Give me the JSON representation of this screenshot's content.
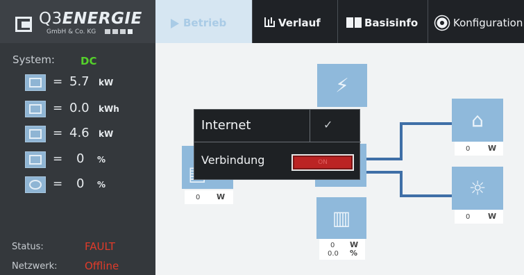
{
  "brand": {
    "name_light": "Q3",
    "name_bold": "ENERGIE",
    "subline": "GmbH & Co. KG"
  },
  "nav": {
    "tabs": [
      {
        "label": "Betrieb",
        "icon": "play-icon",
        "active": true
      },
      {
        "label": "Verlauf",
        "icon": "bar-chart-icon"
      },
      {
        "label": "Basisinfo",
        "icon": "book-icon"
      },
      {
        "label": "Konfiguration",
        "icon": "gear-icon"
      }
    ]
  },
  "sidebar": {
    "system_label": "System:",
    "system_value": "DC",
    "metrics": [
      {
        "icon": "solar-panel-icon",
        "eq": "=",
        "value": "5.7",
        "unit": "kW"
      },
      {
        "icon": "battery-icon",
        "eq": "=",
        "value": "0.0",
        "unit": "kWh"
      },
      {
        "icon": "inverter-icon",
        "eq": "=",
        "value": "4.6",
        "unit": "kW"
      },
      {
        "icon": "solar-percent-icon",
        "eq": "=",
        "value": "0",
        "unit": "%"
      },
      {
        "icon": "cycle-icon",
        "eq": "=",
        "value": "0",
        "unit": "%"
      }
    ],
    "status_label": "Status:",
    "status_value": "FAULT",
    "network_label": "Netzwerk:",
    "network_value": "Offline"
  },
  "diagram": {
    "pv": {
      "value": "0",
      "unit": "W"
    },
    "house": {
      "value": "0",
      "unit": "W"
    },
    "light": {
      "value": "0",
      "unit": "W"
    },
    "battery": {
      "value": "0",
      "unit": "W",
      "value2": "0.0",
      "unit2": "%"
    }
  },
  "popup": {
    "title": "Internet",
    "check": "✓",
    "row_label": "Verbindung",
    "toggle_label": "ON"
  },
  "colors": {
    "accent": "#8fb9db",
    "ok": "#55d12b",
    "fault": "#e03b2a",
    "line": "#3f6fa7"
  }
}
